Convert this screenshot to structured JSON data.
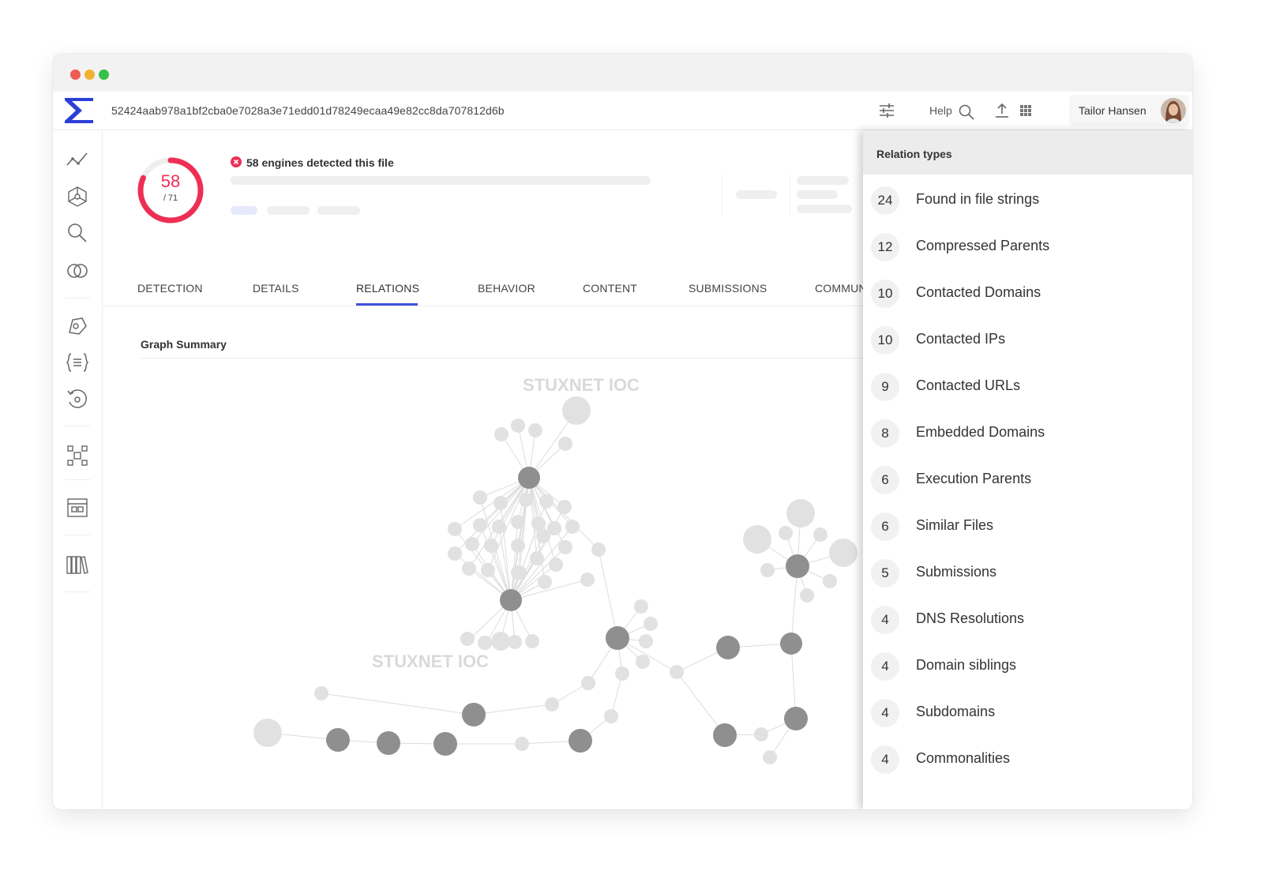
{
  "file_hash": "52424aab978a1bf2cba0e7028a3e71edd01d78249ecaa49e82cc8da707812d6b",
  "toolbar": {
    "help_label": "Help"
  },
  "user": {
    "name": "Tailor Hansen"
  },
  "detection": {
    "detected": 58,
    "total_label": "/ 71",
    "summary": "58 engines detected this file",
    "ratio": 0.817
  },
  "tabs": [
    {
      "label": "DETECTION"
    },
    {
      "label": "DETAILS"
    },
    {
      "label": "RELATIONS"
    },
    {
      "label": "BEHAVIOR"
    },
    {
      "label": "CONTENT"
    },
    {
      "label": "SUBMISSIONS"
    },
    {
      "label": "COMMUN"
    }
  ],
  "graph": {
    "title": "Graph Summary",
    "watermark_top": "STUXNET IOC",
    "watermark_bottom": "STUXNET IOC"
  },
  "relations_panel": {
    "title": "Relation types",
    "items": [
      {
        "count": "24",
        "label": "Found in file strings"
      },
      {
        "count": "12",
        "label": "Compressed Parents"
      },
      {
        "count": "10",
        "label": "Contacted Domains"
      },
      {
        "count": "10",
        "label": "Contacted IPs"
      },
      {
        "count": "9",
        "label": "Contacted URLs"
      },
      {
        "count": "8",
        "label": "Embedded Domains"
      },
      {
        "count": "6",
        "label": "Execution Parents"
      },
      {
        "count": "6",
        "label": "Similar Files"
      },
      {
        "count": "5",
        "label": "Submissions"
      },
      {
        "count": "4",
        "label": "DNS Resolutions"
      },
      {
        "count": "4",
        "label": "Domain siblings"
      },
      {
        "count": "4",
        "label": "Subdomains"
      },
      {
        "count": "4",
        "label": "Commonalities"
      }
    ]
  },
  "colors": {
    "accent": "#3f51d8",
    "danger": "#ee2f55",
    "node_dark": "#8f8f8f",
    "node_light": "#e1e1e1"
  }
}
